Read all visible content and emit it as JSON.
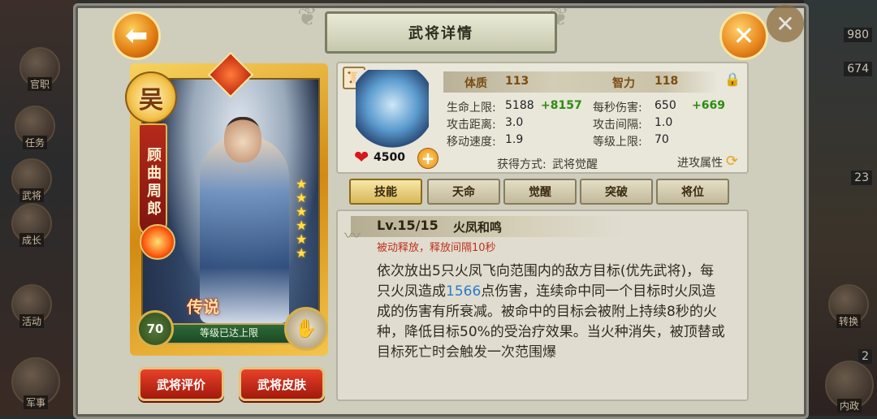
{
  "panel": {
    "title": "武将详情"
  },
  "card": {
    "faction": "吴",
    "hero_name": "顾曲周郎",
    "rarity_label": "传说",
    "level": "70",
    "level_status": "等级已达上限",
    "stars": 6
  },
  "buttons": {
    "rate": "武将评价",
    "skin": "武将皮肤"
  },
  "stats": {
    "hp_value": "4500",
    "constitution_label": "体质",
    "constitution_value": "113",
    "intellect_label": "智力",
    "intellect_value": "118",
    "max_hp_label": "生命上限:",
    "max_hp_value": "5188",
    "max_hp_bonus": "+8157",
    "dps_label": "每秒伤害:",
    "dps_value": "650",
    "dps_bonus": "+669",
    "range_label": "攻击距离:",
    "range_value": "3.0",
    "interval_label": "攻击间隔:",
    "interval_value": "1.0",
    "speed_label": "移动速度:",
    "speed_value": "1.9",
    "maxlv_label": "等级上限:",
    "maxlv_value": "70",
    "obtain_label": "获得方式:",
    "obtain_value": "武将觉醒",
    "attr_link": "进攻属性"
  },
  "tabs": [
    {
      "label": "技能",
      "active": true
    },
    {
      "label": "天命",
      "active": false
    },
    {
      "label": "觉醒",
      "active": false
    },
    {
      "label": "突破",
      "active": false
    },
    {
      "label": "将位",
      "active": false
    }
  ],
  "skill": {
    "level": "Lv.15/15",
    "name": "火凤和鸣",
    "trigger": "被动释放，释放间隔10秒",
    "desc_1": "依次放出5只火凤飞向范围内的敌方目标(优先武将)，每只火凤造成",
    "desc_damage": "1566",
    "desc_2": "点伤害，连续命中同一个目标时火凤造成的伤害有所衰减。被命中的目标会被附上持续8秒的火种，降低目标50%的受治疗效果。当火种消失，被顶替或目标死亡时会触发一次范围爆"
  },
  "background": {
    "left_labels": [
      "官职",
      "任务",
      "武将",
      "成长",
      "活动",
      "军事"
    ],
    "right_numbers": [
      "980",
      "674",
      "23",
      "2"
    ],
    "right_labels": [
      "转换",
      "内政"
    ]
  },
  "colors": {
    "accent_orange": "#e6841b",
    "button_red": "#c02a14",
    "bonus_green": "#2c8c12",
    "highlight_blue": "#2a7bc9"
  }
}
